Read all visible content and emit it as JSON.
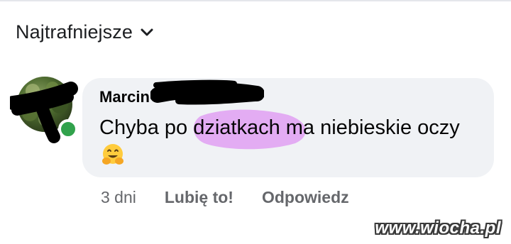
{
  "comments_section": {
    "sort_label": "Najtrafniejsze",
    "sort_icon": "chevron-down-icon"
  },
  "comment": {
    "author": "Marcin",
    "text": "Chyba po dziatkach ma niebieskie oczy",
    "emoji": "🤗",
    "online": true,
    "online_color": "#31a24c",
    "time": "3 dni",
    "like_label": "Lubię to!",
    "reply_label": "Odpowiedz",
    "bubble_color": "#f0f2f5",
    "highlight_color": "#e2a8f2"
  },
  "watermark": {
    "text": "www.wiocha.pl"
  }
}
